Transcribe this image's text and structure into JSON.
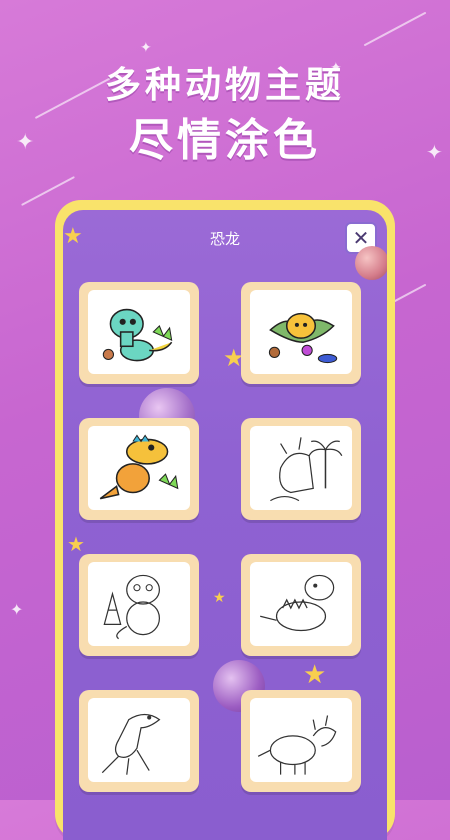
{
  "headline": {
    "line1": "多种动物主题",
    "line2": "尽情涂色"
  },
  "app": {
    "title": "恐龙",
    "close_icon": "close-icon"
  },
  "cards": [
    {
      "name": "green-dino",
      "colored": true
    },
    {
      "name": "pterosaur",
      "colored": true
    },
    {
      "name": "t-rex-orange",
      "colored": true
    },
    {
      "name": "triceratops-outline",
      "colored": false
    },
    {
      "name": "baby-dino-outline",
      "colored": false
    },
    {
      "name": "stegosaurus-outline",
      "colored": false
    },
    {
      "name": "t-rex-outline",
      "colored": false
    },
    {
      "name": "triceratops-walking-outline",
      "colored": false
    }
  ],
  "colors": {
    "background": "#c766d0",
    "frame": "#f9e36b",
    "screen": "#9365d3",
    "card": "#f8ddb0"
  }
}
